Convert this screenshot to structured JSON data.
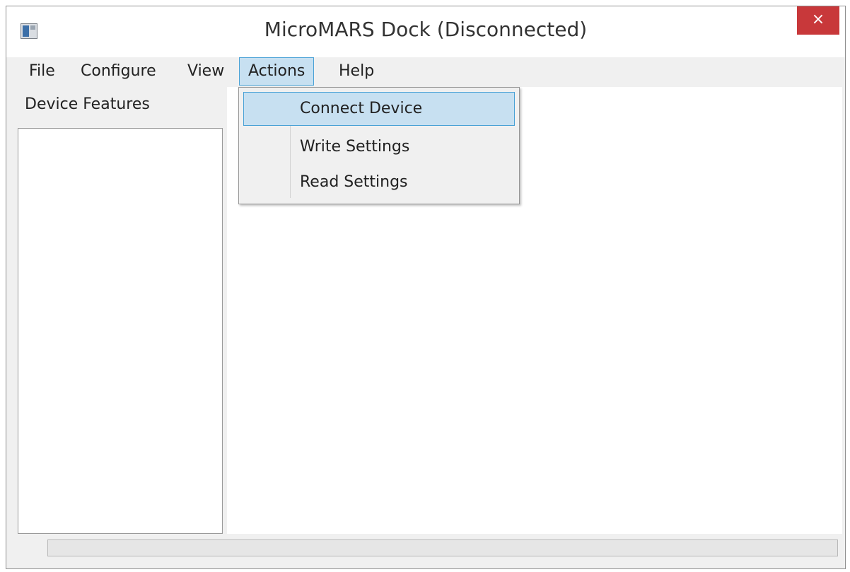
{
  "window": {
    "title": "MicroMARS Dock (Disconnected)",
    "close_glyph": "×",
    "app_icon": "app-window-icon"
  },
  "menubar": {
    "items": [
      {
        "label": "File"
      },
      {
        "label": "Configure"
      },
      {
        "label": "View"
      },
      {
        "label": "Actions"
      },
      {
        "label": "Help"
      }
    ],
    "open_menu": "Actions"
  },
  "actions_menu": {
    "items": [
      {
        "label": "Connect Device",
        "highlighted": true
      },
      {
        "label": "Write Settings"
      },
      {
        "label": "Read Settings"
      }
    ]
  },
  "left_panel": {
    "title": "Device Features"
  },
  "colors": {
    "close_button": "#c8383a",
    "highlight_fill": "#c7e0f1",
    "highlight_border": "#4aa2d6",
    "chrome": "#f0f0f0"
  }
}
